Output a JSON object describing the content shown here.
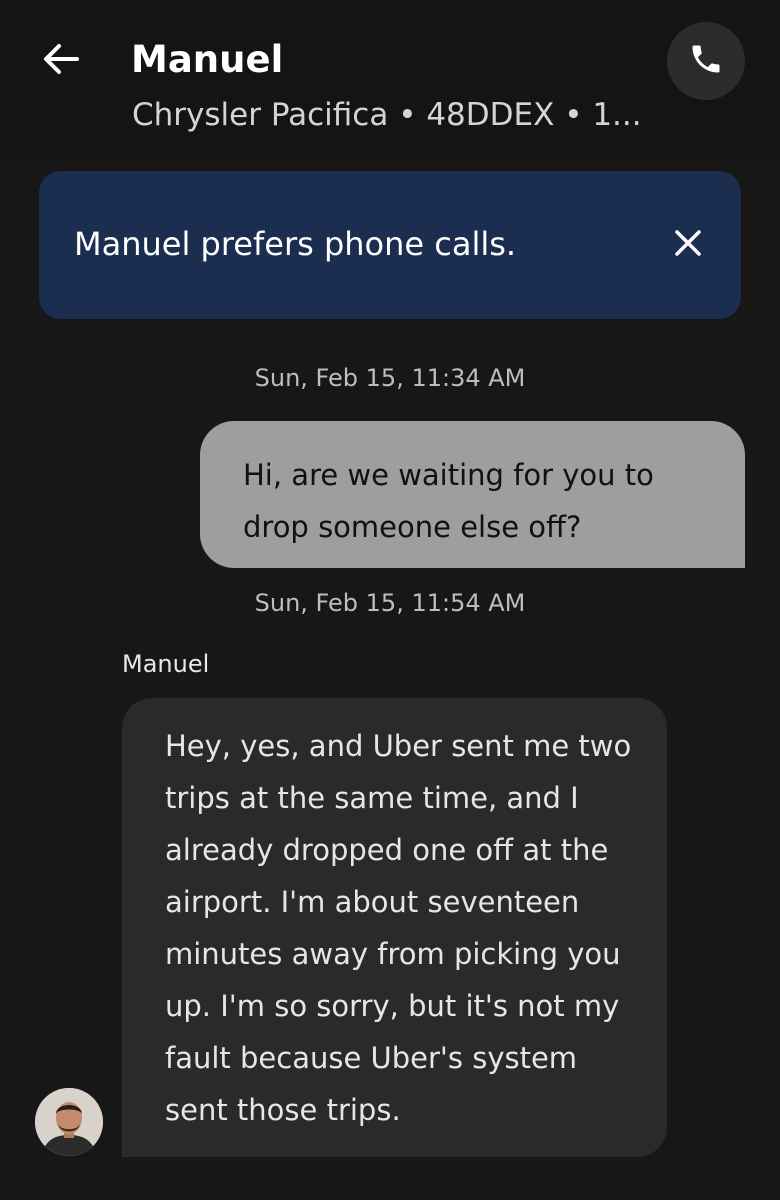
{
  "header": {
    "title": "Manuel",
    "subtitle": "Chrysler Pacifica • 48DDEX • 1..."
  },
  "icons": {
    "back": "arrow-left-icon",
    "call": "phone-icon",
    "close": "close-icon"
  },
  "banner": {
    "text": "Manuel prefers phone calls."
  },
  "messages": [
    {
      "timestamp": "Sun, Feb 15, 11:34 AM",
      "direction": "outgoing",
      "text": "Hi, are we waiting for you to drop someone else off?"
    },
    {
      "timestamp": "Sun, Feb 15, 11:54 AM",
      "direction": "incoming",
      "sender": "Manuel",
      "text": "Hey, yes, and Uber sent me two trips at the same time, and I already dropped one off at the airport. I'm about seventeen minutes away from picking you up. I'm so sorry, but it's not my fault because Uber's system sent those trips."
    }
  ],
  "colors": {
    "background": "#171717",
    "banner": "#1c2e4f",
    "outgoing_bubble": "#9e9e9e",
    "incoming_bubble": "#2a2a2a"
  }
}
